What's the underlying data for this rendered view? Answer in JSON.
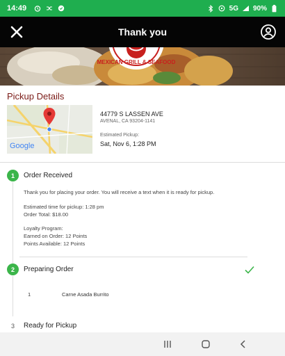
{
  "status_bar": {
    "time": "14:49",
    "network": "5G",
    "battery": "90%"
  },
  "app_bar": {
    "title": "Thank you"
  },
  "hero": {
    "logo_text": "MEXICAN GRILL & SEAFOOD"
  },
  "pickup": {
    "title": "Pickup Details",
    "map_logo": "Google",
    "address_line1": "44779 S LASSEN AVE",
    "address_line2": "AVENAL, CA 93204-1141",
    "estimated_label": "Estimated Pickup:",
    "estimated_value": "Sat, Nov 6, 1:28 PM"
  },
  "steps": [
    {
      "number": "1",
      "title": "Order Received",
      "message": "Thank you for placing your order. You will receive a text when it is ready for pickup.",
      "estimated_time": "Estimated time for pickup: 1:28 pm",
      "order_total": "Order Total: $18.00",
      "loyalty_label": "Loyalty Program:",
      "earned": "Earned on Order: 12 Points",
      "available": "Points Available: 12 Points"
    },
    {
      "number": "2",
      "title": "Preparing Order",
      "items": [
        {
          "qty": "1",
          "name": "Carne Asada Burrito"
        }
      ]
    },
    {
      "number": "3",
      "title": "Ready for Pickup"
    }
  ],
  "colors": {
    "status_green": "#1fae4f",
    "step_green": "#3bb54a",
    "pickup_title": "#7a1a16",
    "check_green": "#3bb54a"
  },
  "icons": {
    "close": "close-icon",
    "account": "account-icon",
    "check": "check-icon",
    "map_pin": "map-pin-icon"
  }
}
